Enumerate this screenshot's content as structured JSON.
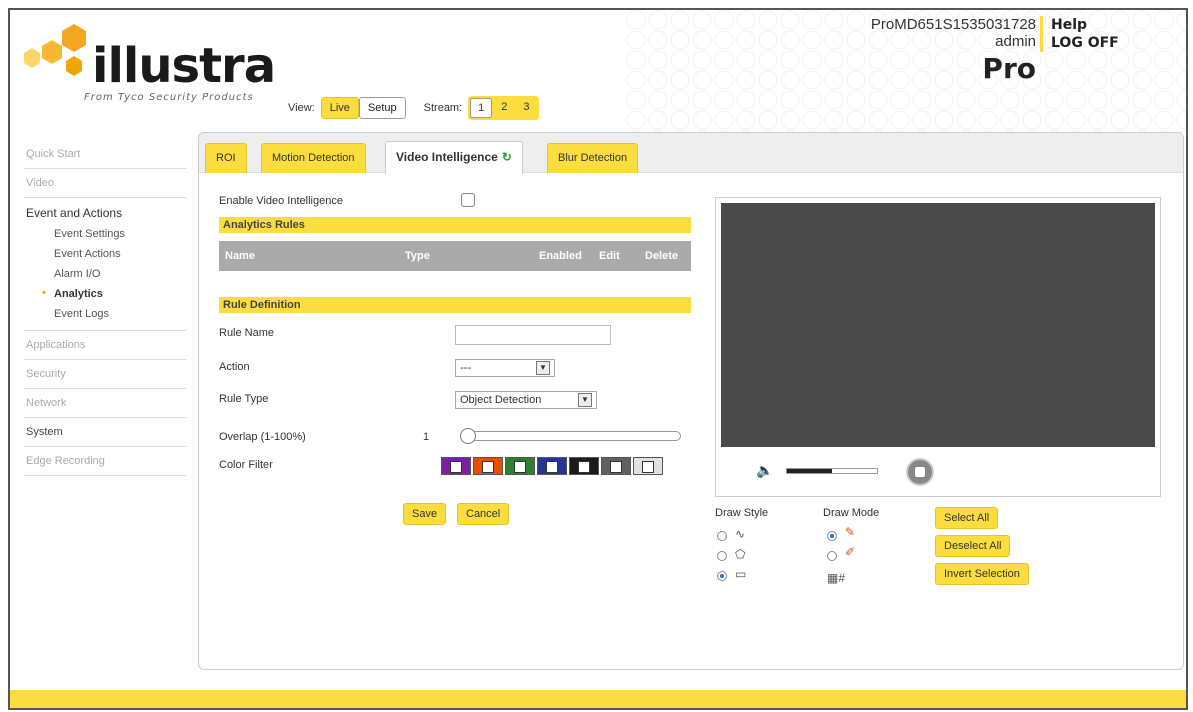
{
  "brand": {
    "name": "illustra",
    "tagline": "From Tyco Security Products"
  },
  "header": {
    "model": "ProMD651S1535031728",
    "user": "admin",
    "edition": "Pro",
    "help": "Help",
    "logoff": "LOG OFF"
  },
  "viewbar": {
    "view_label": "View:",
    "live": "Live",
    "setup": "Setup",
    "stream_label": "Stream:",
    "streams": [
      "1",
      "2",
      "3"
    ]
  },
  "sidebar": {
    "quick_start": "Quick Start",
    "video": "Video",
    "events_head": "Event and Actions",
    "event_settings": "Event Settings",
    "event_actions": "Event Actions",
    "alarm_io": "Alarm I/O",
    "analytics": "Analytics",
    "event_logs": "Event Logs",
    "applications": "Applications",
    "security": "Security",
    "network": "Network",
    "system": "System",
    "edge_recording": "Edge Recording"
  },
  "tabs": {
    "roi": "ROI",
    "motion": "Motion Detection",
    "vi": "Video Intelligence",
    "blur": "Blur Detection"
  },
  "form": {
    "enable_label": "Enable Video Intelligence",
    "analytics_rules": "Analytics Rules",
    "columns": {
      "name": "Name",
      "type": "Type",
      "enabled": "Enabled",
      "edit": "Edit",
      "delete": "Delete"
    },
    "rule_definition": "Rule Definition",
    "rule_name_label": "Rule Name",
    "rule_name_value": "",
    "action_label": "Action",
    "action_value": "---",
    "rule_type_label": "Rule Type",
    "rule_type_value": "Object Detection",
    "overlap_label": "Overlap (1-100%)",
    "overlap_value": "1",
    "color_filter_label": "Color Filter",
    "save": "Save",
    "cancel": "Cancel"
  },
  "color_swatches": [
    "#7b1fa2",
    "#e65100",
    "#2e7d32",
    "#283593",
    "#1a1a1a",
    "#616161",
    "#e0e0e0"
  ],
  "draw": {
    "style_label": "Draw Style",
    "mode_label": "Draw Mode",
    "select_all": "Select All",
    "deselect_all": "Deselect All",
    "invert": "Invert Selection"
  },
  "audio": {
    "volume_fraction": 0.5
  },
  "colors": {
    "accent": "#fcdd3f",
    "video_bg": "#4a4a4a"
  }
}
